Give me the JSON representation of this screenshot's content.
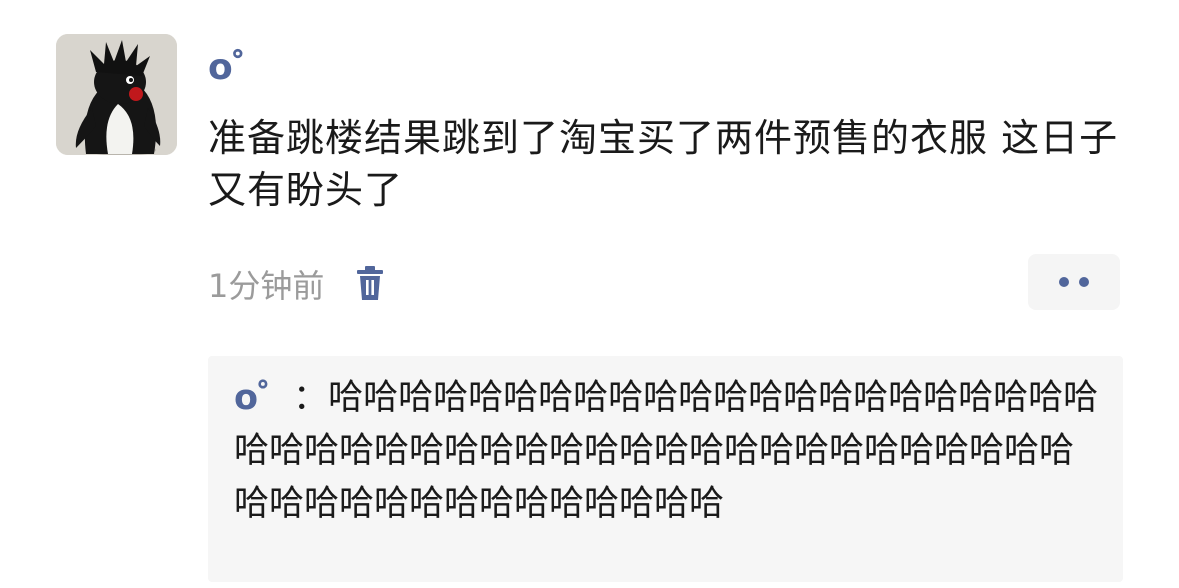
{
  "post": {
    "username": "o゜",
    "text": "准备跳楼结果跳到了淘宝买了两件预售的衣服 这日子又有盼头了",
    "timestamp": "1分钟前"
  },
  "icons": {
    "delete": "trash-icon",
    "more": "more-dots-icon"
  },
  "comment": {
    "author": "o゜",
    "separator": "：",
    "text": "哈哈哈哈哈哈哈哈哈哈哈哈哈哈哈哈哈哈哈哈哈哈哈哈哈哈哈哈哈哈哈哈哈哈哈哈哈哈哈哈哈哈哈哈哈哈哈哈哈哈哈哈哈哈哈哈哈哈哈哈"
  },
  "colors": {
    "accent": "#51669b",
    "timestamp": "#9b9b9b",
    "panel": "#f6f6f6",
    "text": "#1a1a1a"
  }
}
